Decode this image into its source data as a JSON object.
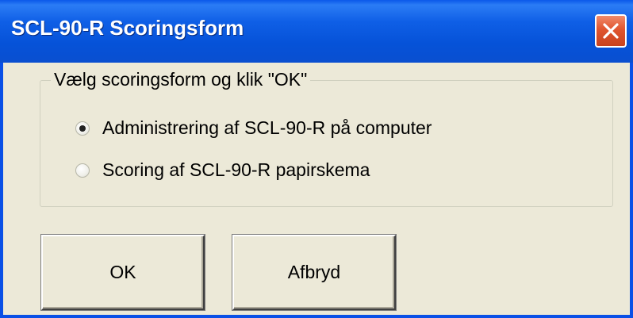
{
  "window": {
    "title": "SCL-90-R Scoringsform",
    "close_icon": "close-icon"
  },
  "group": {
    "legend": "Vælg scoringsform og klik \"OK\"",
    "options": [
      {
        "label": "Administrering af SCL-90-R på computer",
        "selected": true
      },
      {
        "label": "Scoring af SCL-90-R papirskema",
        "selected": false
      }
    ]
  },
  "buttons": {
    "ok_label": "OK",
    "cancel_label": "Afbryd"
  },
  "colors": {
    "titlebar": "#0a58ea",
    "close": "#e0552f",
    "face": "#ece9d8"
  }
}
